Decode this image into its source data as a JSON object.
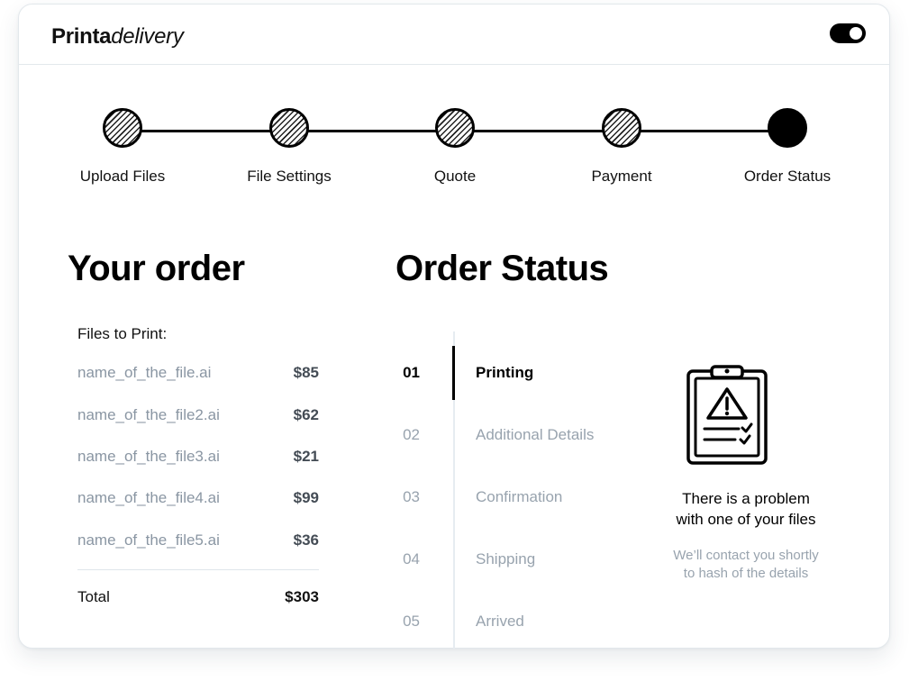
{
  "app": {
    "brand_bold": "Printa",
    "brand_italic": "delivery",
    "toggle_state": "on"
  },
  "stepper": {
    "steps": [
      {
        "label": "Upload Files",
        "state": "done"
      },
      {
        "label": "File Settings",
        "state": "done"
      },
      {
        "label": "Quote",
        "state": "done"
      },
      {
        "label": "Payment",
        "state": "done"
      },
      {
        "label": "Order Status",
        "state": "current"
      }
    ]
  },
  "order": {
    "title": "Your order",
    "files_label": "Files to Print:",
    "files": [
      {
        "name": "name_of_the_file.ai",
        "price": "$85"
      },
      {
        "name": "name_of_the_file2.ai",
        "price": "$62"
      },
      {
        "name": "name_of_the_file3.ai",
        "price": "$21"
      },
      {
        "name": "name_of_the_file4.ai",
        "price": "$99"
      },
      {
        "name": "name_of_the_file5.ai",
        "price": "$36"
      }
    ],
    "total_label": "Total",
    "total_value": "$303"
  },
  "status": {
    "title": "Order Status",
    "items": [
      {
        "num": "01",
        "label": "Printing",
        "active": true
      },
      {
        "num": "02",
        "label": "Additional Details",
        "active": false
      },
      {
        "num": "03",
        "label": "Confirmation",
        "active": false
      },
      {
        "num": "04",
        "label": "Shipping",
        "active": false
      },
      {
        "num": "05",
        "label": "Arrived",
        "active": false
      }
    ]
  },
  "problem": {
    "icon": "clipboard-warning-icon",
    "title_line1": "There is a problem",
    "title_line2": "with one of your files",
    "sub_line1": "We’ll contact you shortly",
    "sub_line2": "to hash of the details"
  },
  "colors": {
    "accent": "#000000",
    "muted_text": "#98a3ae",
    "border": "#e3e8ec"
  }
}
